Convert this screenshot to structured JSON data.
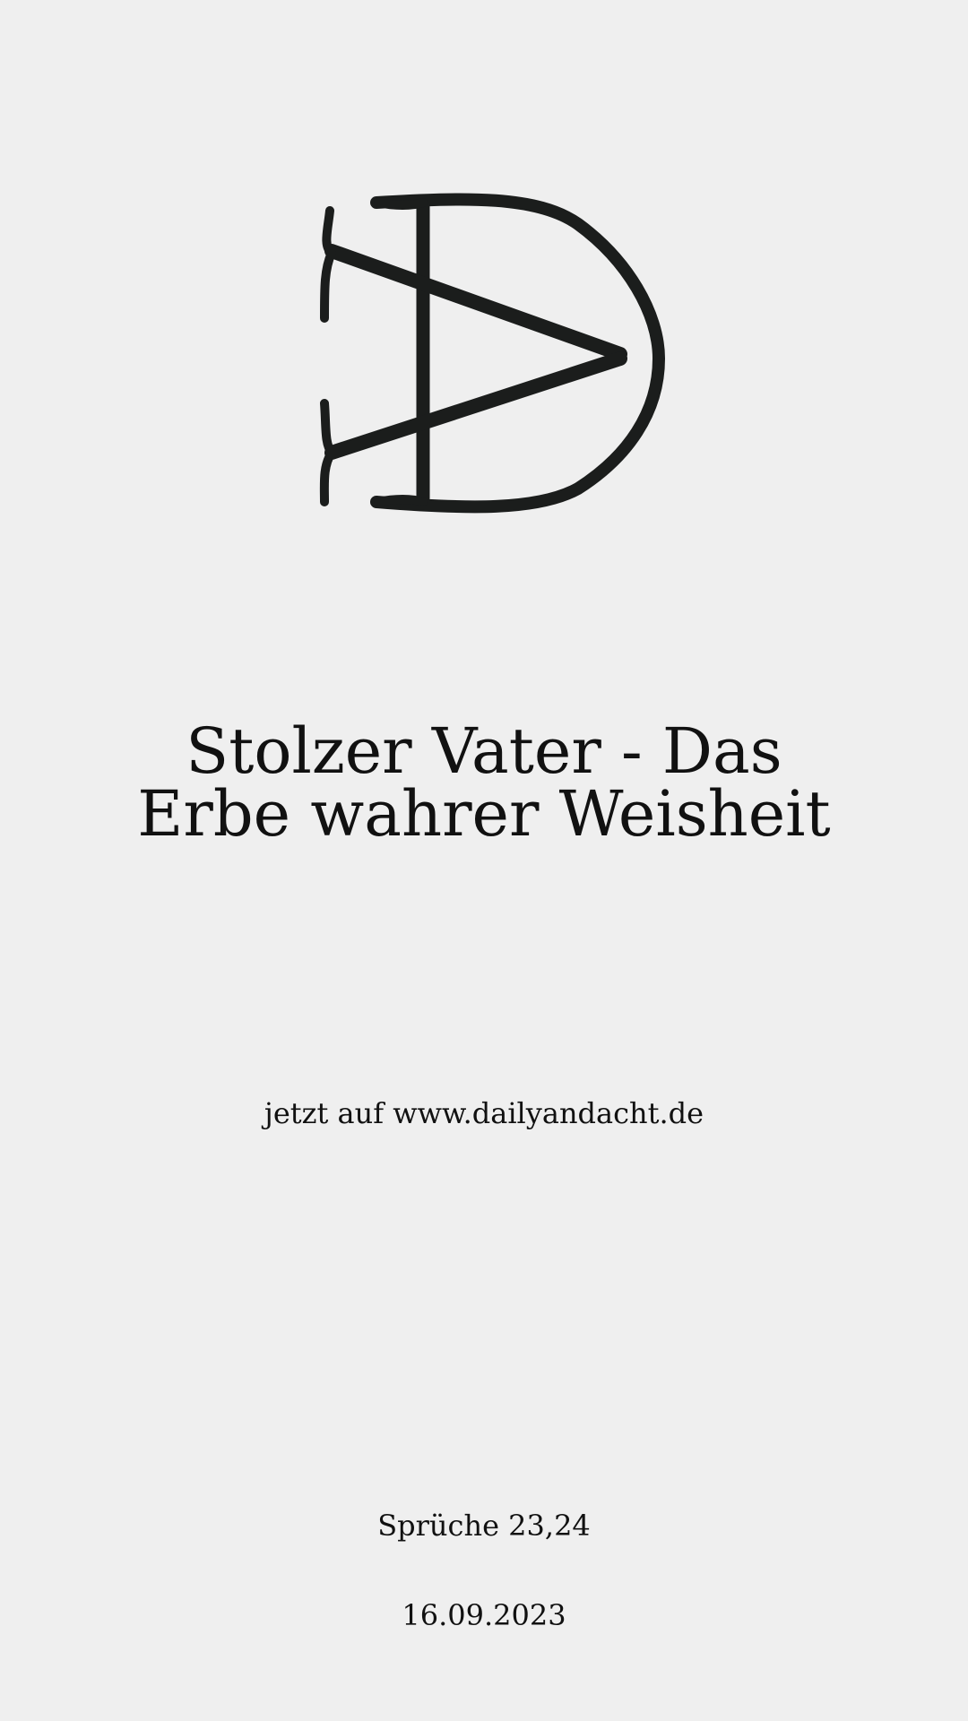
{
  "logo": {
    "icon": "dv-monogram-logo",
    "color": "#1b1d1c"
  },
  "title": {
    "line1": "Stolzer Vater - Das",
    "line2": "Erbe wahrer Weisheit"
  },
  "promo": {
    "text": "jetzt auf www.dailyandacht.de"
  },
  "reference": {
    "text": "Sprüche 23,24"
  },
  "date": {
    "text": "16.09.2023"
  },
  "colors": {
    "background": "#efefef",
    "text": "#111111"
  }
}
